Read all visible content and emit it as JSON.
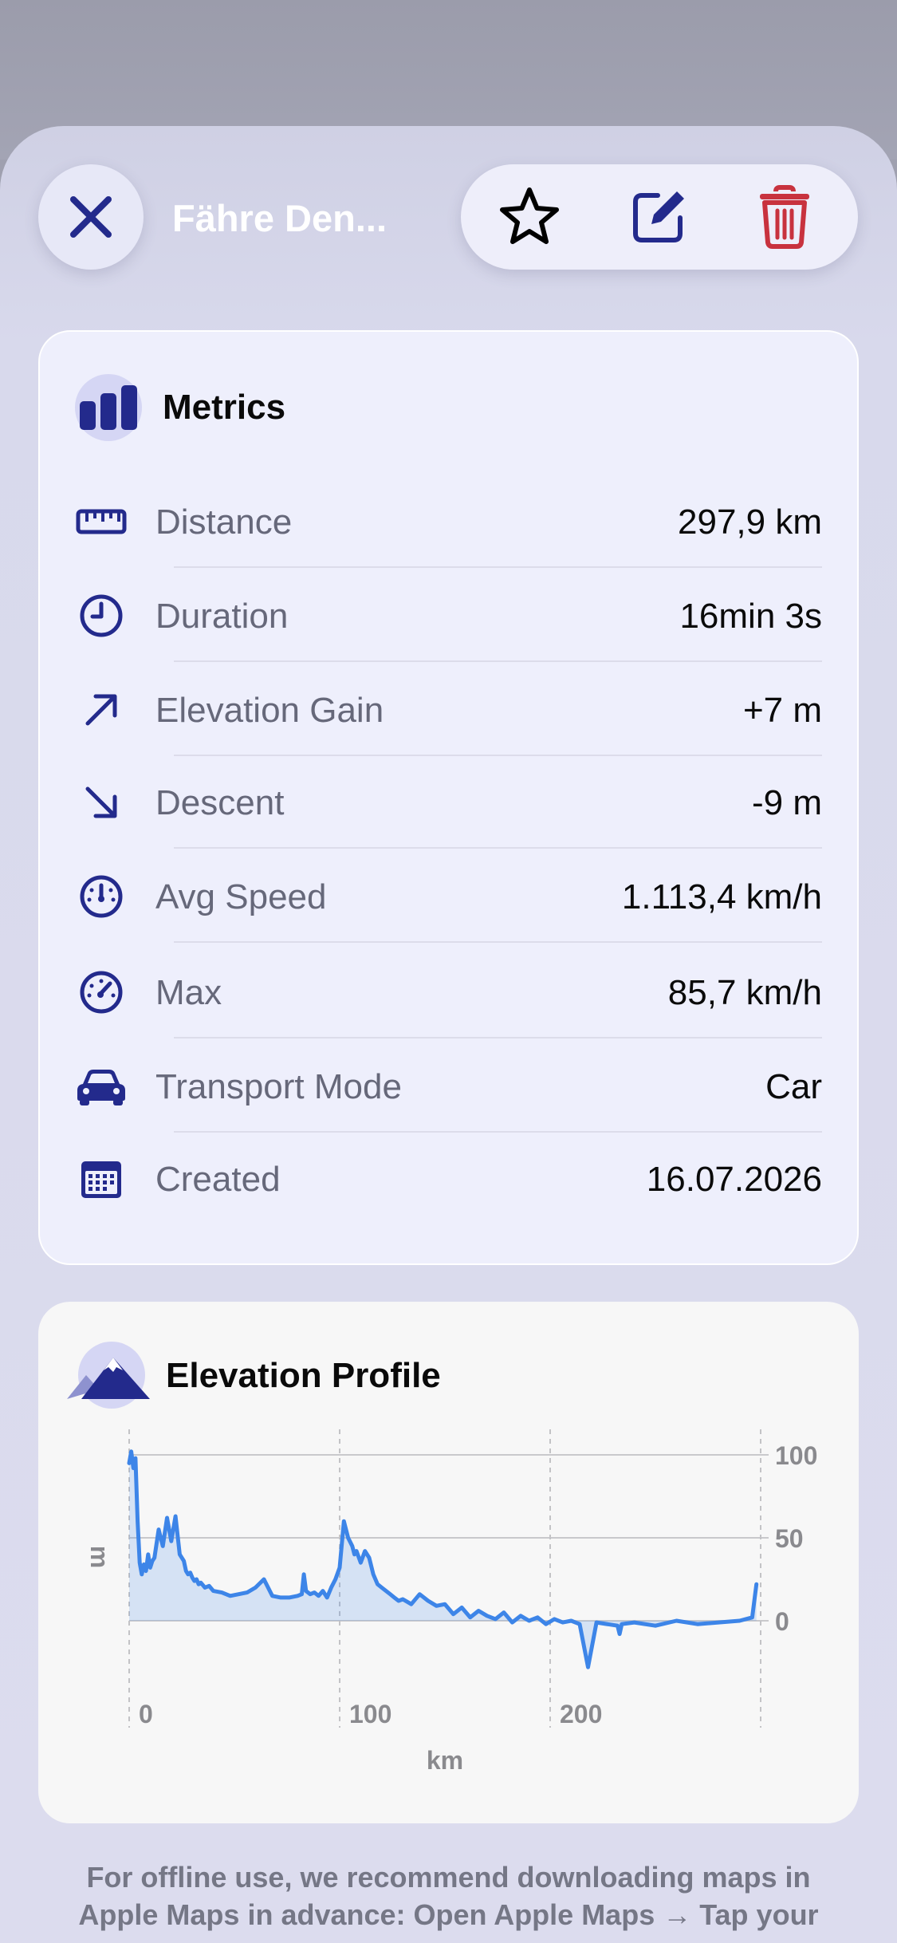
{
  "header": {
    "title": "Fähre Den...",
    "close_icon": "close-icon",
    "favorite_icon": "star-icon",
    "edit_icon": "edit-icon",
    "delete_icon": "trash-icon"
  },
  "metrics": {
    "title": "Metrics",
    "rows": [
      {
        "label": "Distance",
        "value": "297,9 km",
        "icon": "ruler-icon"
      },
      {
        "label": "Duration",
        "value": "16min 3s",
        "icon": "clock-icon"
      },
      {
        "label": "Elevation Gain",
        "value": "+7 m",
        "icon": "arrow-up-right-icon"
      },
      {
        "label": "Descent",
        "value": "-9 m",
        "icon": "arrow-down-right-icon"
      },
      {
        "label": "Avg Speed",
        "value": "1.113,4 km/h",
        "icon": "gauge-icon"
      },
      {
        "label": "Max",
        "value": "85,7 km/h",
        "icon": "speedometer-icon"
      },
      {
        "label": "Transport Mode",
        "value": "Car",
        "icon": "car-icon"
      },
      {
        "label": "Created",
        "value": "16.07.2026",
        "icon": "calendar-icon"
      }
    ]
  },
  "elevation": {
    "title": "Elevation Profile"
  },
  "chart_data": {
    "type": "area",
    "title": "Elevation Profile",
    "xlabel": "km",
    "ylabel": "m",
    "xlim": [
      0,
      300
    ],
    "ylim": [
      -30,
      105
    ],
    "x_ticks": [
      0,
      100,
      200
    ],
    "x_tick_labels": [
      "0",
      "100",
      "200"
    ],
    "y_ticks": [
      0,
      50,
      100
    ],
    "y_tick_labels": [
      "0",
      "50",
      "100"
    ],
    "grid": true,
    "series": [
      {
        "color": "#3d85e8",
        "x": [
          0,
          1,
          2,
          3,
          4,
          5,
          6,
          7,
          8,
          9,
          10,
          11,
          12,
          14,
          16,
          18,
          20,
          22,
          24,
          26,
          27,
          28,
          29,
          30,
          31,
          32,
          33,
          34,
          36,
          38,
          40,
          44,
          48,
          52,
          56,
          60,
          64,
          68,
          72,
          76,
          80,
          82,
          83,
          84,
          86,
          88,
          90,
          92,
          94,
          96,
          98,
          100,
          102,
          104,
          106,
          107,
          108,
          110,
          112,
          114,
          116,
          118,
          120,
          122,
          124,
          126,
          128,
          130,
          134,
          138,
          142,
          146,
          150,
          154,
          158,
          162,
          166,
          170,
          174,
          178,
          182,
          186,
          190,
          194,
          198,
          202,
          206,
          210,
          214,
          218,
          222,
          232,
          233,
          234,
          240,
          250,
          260,
          270,
          280,
          290,
          296,
          298
        ],
        "y": [
          95,
          102,
          92,
          98,
          60,
          35,
          28,
          34,
          30,
          40,
          32,
          36,
          38,
          55,
          45,
          62,
          48,
          63,
          40,
          36,
          30,
          28,
          29,
          26,
          24,
          25,
          22,
          23,
          20,
          21,
          18,
          17,
          15,
          16,
          17,
          20,
          25,
          15,
          14,
          14,
          15,
          16,
          28,
          18,
          16,
          17,
          15,
          18,
          14,
          20,
          25,
          32,
          60,
          50,
          45,
          40,
          42,
          35,
          42,
          38,
          28,
          22,
          20,
          18,
          16,
          14,
          12,
          13,
          10,
          16,
          12,
          9,
          10,
          4,
          8,
          2,
          6,
          3,
          1,
          5,
          -1,
          3,
          0,
          2,
          -2,
          1,
          -1,
          0,
          -2,
          -28,
          -1,
          -3,
          -8,
          -2,
          -1,
          -3,
          0,
          -2,
          -1,
          0,
          2,
          22
        ]
      }
    ]
  },
  "footer": {
    "note_line1": "For offline use, we recommend downloading maps in",
    "note_line2": "Apple Maps in advance: Open Apple Maps → Tap your"
  }
}
